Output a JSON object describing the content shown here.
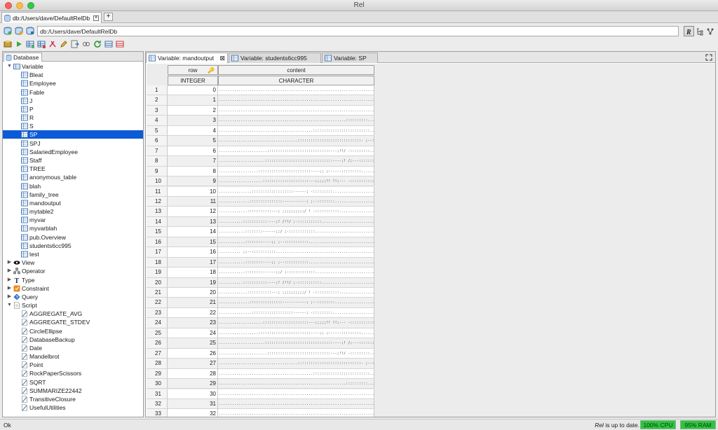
{
  "window": {
    "title": "Rel"
  },
  "doc_tab": {
    "label": "db:/Users/dave/DefaultRelDb"
  },
  "url_bar": {
    "value": "db:/Users/dave/DefaultRelDb"
  },
  "left_panel": {
    "tab_label": "Database",
    "tree": [
      {
        "label": "Variable",
        "level": 0,
        "expanded": true,
        "icon": "variable-folder-icon"
      },
      {
        "label": "Bleat",
        "level": 1,
        "icon": "table-icon"
      },
      {
        "label": "Employee",
        "level": 1,
        "icon": "table-icon"
      },
      {
        "label": "Fable",
        "level": 1,
        "icon": "table-icon"
      },
      {
        "label": "J",
        "level": 1,
        "icon": "table-icon"
      },
      {
        "label": "P",
        "level": 1,
        "icon": "table-icon"
      },
      {
        "label": "R",
        "level": 1,
        "icon": "table-icon"
      },
      {
        "label": "S",
        "level": 1,
        "icon": "table-icon"
      },
      {
        "label": "SP",
        "level": 1,
        "icon": "table-icon",
        "selected": true
      },
      {
        "label": "SPJ",
        "level": 1,
        "icon": "table-icon"
      },
      {
        "label": "SalariedEmployee",
        "level": 1,
        "icon": "table-icon"
      },
      {
        "label": "Staff",
        "level": 1,
        "icon": "table-icon"
      },
      {
        "label": "TREE",
        "level": 1,
        "icon": "table-icon"
      },
      {
        "label": "anonymous_table",
        "level": 1,
        "icon": "table-icon"
      },
      {
        "label": "blah",
        "level": 1,
        "icon": "table-icon"
      },
      {
        "label": "family_tree",
        "level": 1,
        "icon": "table-icon"
      },
      {
        "label": "mandoutput",
        "level": 1,
        "icon": "table-icon"
      },
      {
        "label": "mytable2",
        "level": 1,
        "icon": "table-icon"
      },
      {
        "label": "myvar",
        "level": 1,
        "icon": "table-icon"
      },
      {
        "label": "myvarblah",
        "level": 1,
        "icon": "table-icon"
      },
      {
        "label": "pub.Overview",
        "level": 1,
        "icon": "table-icon"
      },
      {
        "label": "students6cc995",
        "level": 1,
        "icon": "table-icon"
      },
      {
        "label": "test",
        "level": 1,
        "icon": "table-icon"
      },
      {
        "label": "View",
        "level": 0,
        "expanded": false,
        "icon": "eye-icon"
      },
      {
        "label": "Operator",
        "level": 0,
        "expanded": false,
        "icon": "operator-icon"
      },
      {
        "label": "Type",
        "level": 0,
        "expanded": false,
        "icon": "type-icon"
      },
      {
        "label": "Constraint",
        "level": 0,
        "expanded": false,
        "icon": "constraint-icon"
      },
      {
        "label": "Query",
        "level": 0,
        "expanded": false,
        "icon": "query-icon"
      },
      {
        "label": "Script",
        "level": 0,
        "expanded": true,
        "icon": "script-folder-icon"
      },
      {
        "label": "AGGREGATE_AVG",
        "level": 1,
        "icon": "script-icon"
      },
      {
        "label": "AGGREGATE_STDEV",
        "level": 1,
        "icon": "script-icon"
      },
      {
        "label": "CircleEllipse",
        "level": 1,
        "icon": "script-icon"
      },
      {
        "label": "DatabaseBackup",
        "level": 1,
        "icon": "script-icon"
      },
      {
        "label": "Date",
        "level": 1,
        "icon": "script-icon"
      },
      {
        "label": "Mandelbrot",
        "level": 1,
        "icon": "script-icon"
      },
      {
        "label": "Point",
        "level": 1,
        "icon": "script-icon"
      },
      {
        "label": "RockPaperScissors",
        "level": 1,
        "icon": "script-icon"
      },
      {
        "label": "SQRT",
        "level": 1,
        "icon": "script-icon"
      },
      {
        "label": "SUMMARIZE22442",
        "level": 1,
        "icon": "script-icon"
      },
      {
        "label": "TransitiveClosure",
        "level": 1,
        "icon": "script-icon"
      },
      {
        "label": "UsefulUtilities",
        "level": 1,
        "icon": "script-icon"
      }
    ]
  },
  "right_panel": {
    "tabs": [
      {
        "label": "Variable: mandoutput",
        "active": true,
        "closable": true
      },
      {
        "label": "Variable: students6cc995",
        "active": false,
        "closable": false
      },
      {
        "label": "Variable: SP",
        "active": false,
        "closable": false
      }
    ],
    "columns": [
      {
        "name": "row",
        "type": "INTEGER",
        "key": true
      },
      {
        "name": "content",
        "type": "CHARACTER",
        "key": false
      }
    ],
    "rows": [
      {
        "n": "1",
        "row": "0",
        "content": "............................................................................................................................"
      },
      {
        "n": "2",
        "row": "1",
        "content": "............................................................................................................................"
      },
      {
        "n": "3",
        "row": "2",
        "content": "............................................................................................................................"
      },
      {
        "n": "4",
        "row": "3",
        "content": "..........................................................::::::::::........................................................."
      },
      {
        "n": "5",
        "row": "4",
        "content": "...........................................::::::::::::::::::::::::::......................................................."
      },
      {
        "n": "6",
        "row": "5",
        "content": "....................................:::::::::::::::::::::::::::::- ;--:::::::................................................"
      },
      {
        "n": "7",
        "row": "6",
        "content": "......................:::::::::::::::::::::::::::::---;!!/ -:::::::::..............................................."
      },
      {
        "n": "8",
        "row": "7",
        "content": ".....................:::::::::::::::::::::::::::::::----;!  /;---::::::::::................................................."
      },
      {
        "n": "9",
        "row": "8",
        "content": "..................::::::::::::::::::::::::----;;     ;:-----:::::::::................................................."
      },
      {
        "n": "10",
        "row": "9",
        "content": "....................:::::::::::::::::::::---;;;;;!!      !!;--- -:::::::::::.................................................."
      },
      {
        "n": "11",
        "row": "10",
        "content": "...............:::::::::::::::::::------;                       -:::::::::....................................................."
      },
      {
        "n": "12",
        "row": "11",
        "content": "..............:::::::::::::::-----------;                      ;--::::::::....................................................."
      },
      {
        "n": "13",
        "row": "12",
        "content": ".............:::::::::::---; ;;;;;;;;;;/                    ! -:::::::::::..................................................."
      },
      {
        "n": "14",
        "row": "13",
        "content": "...........:::::::::::----;!      /!!/                       ;-:::::::::::..................................................."
      },
      {
        "n": "15",
        "row": "14",
        "content": "............::::::::------;;/                                ;-::::::::::::..................................................."
      },
      {
        "n": "16",
        "row": "15",
        "content": "............::::::::----;;                                   ;--:::::::::::.................................................."
      },
      {
        "n": "17",
        "row": "16",
        "content": "..........                                                ;;--:::::::::::...................................................."
      },
      {
        "n": "18",
        "row": "17",
        "content": "............::::::::----;;                                   ;--:::::::::::.................................................."
      },
      {
        "n": "19",
        "row": "18",
        "content": "............::::::::------;;/                                ;-::::::::::::..................................................."
      },
      {
        "n": "20",
        "row": "19",
        "content": "...........:::::::::::----;!      /!!/                       ;-:::::::::::..................................................."
      },
      {
        "n": "21",
        "row": "20",
        "content": ".............:::::::::::---; ;;;;;;;;;;/                    ! -:::::::::::..................................................."
      },
      {
        "n": "22",
        "row": "21",
        "content": "..............:::::::::::::::-----------;                      ;--::::::::....................................................."
      },
      {
        "n": "23",
        "row": "22",
        "content": "...............:::::::::::::::::::------;                       -:::::::::....................................................."
      },
      {
        "n": "24",
        "row": "23",
        "content": "....................:::::::::::::::::::::---;;;;;!!      !!;--- -:::::::::::.................................................."
      },
      {
        "n": "25",
        "row": "24",
        "content": "..................::::::::::::::::::::::::----;;     ;:-----:::::::::................................................."
      },
      {
        "n": "26",
        "row": "25",
        "content": ".....................:::::::::::::::::::::::::::::::----;!  /;---::::::::::................................................."
      },
      {
        "n": "27",
        "row": "26",
        "content": "......................:::::::::::::::::::::::::::::---;!!/ -:::::::::..............................................."
      },
      {
        "n": "28",
        "row": "27",
        "content": "....................................:::::::::::::::::::::::::::::- ;--:::::::................................................"
      },
      {
        "n": "29",
        "row": "28",
        "content": "...........................................::::::::::::::::::::::::::......................................................."
      },
      {
        "n": "30",
        "row": "29",
        "content": "..........................................................::::::::::........................................................."
      },
      {
        "n": "31",
        "row": "30",
        "content": "............................................................................................................................"
      },
      {
        "n": "32",
        "row": "31",
        "content": "............................................................................................................................"
      },
      {
        "n": "33",
        "row": "32",
        "content": "............................................................................................................................"
      }
    ]
  },
  "status": {
    "left": "Ok",
    "rel_brand": "Rel",
    "rel_text": " is up to date.",
    "cpu": "100% CPU",
    "ram": "95% RAM"
  },
  "colors": {
    "selection": "#0b5bd7",
    "meter_green": "#2ec540"
  }
}
